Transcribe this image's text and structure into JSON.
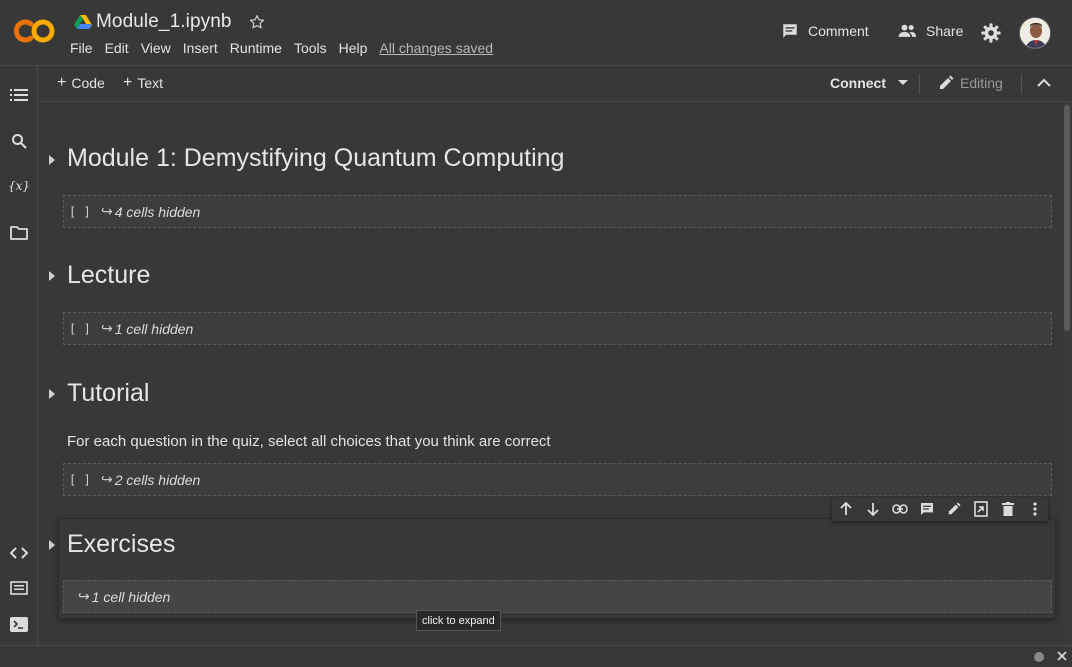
{
  "header": {
    "notebook_title": "Module_1.ipynb",
    "menu": [
      "File",
      "Edit",
      "View",
      "Insert",
      "Runtime",
      "Tools",
      "Help"
    ],
    "save_status": "All changes saved",
    "comment_label": "Comment",
    "share_label": "Share"
  },
  "toolbar": {
    "add_code_label": "Code",
    "add_text_label": "Text",
    "connect_label": "Connect",
    "editing_label": "Editing"
  },
  "rail": {
    "variables_label": "{x}"
  },
  "sections": [
    {
      "heading": "Module 1: Demystifying Quantum Computing",
      "hidden_label": "4 cells hidden"
    },
    {
      "heading": "Lecture",
      "hidden_label": "1 cell hidden"
    },
    {
      "heading": "Tutorial",
      "paragraph": "For each question in the quiz, select all choices that you think are correct",
      "hidden_label": "2 cells hidden"
    },
    {
      "heading": "Exercises",
      "hidden_label": "1 cell hidden"
    }
  ],
  "hidden_cell_prefix": "[ ]",
  "hidden_cell_arrow": "↪",
  "tooltip": "click to expand",
  "colors": {
    "background": "#383838",
    "logo_orange": "#f9ab00",
    "logo_orange_dark": "#e8710a"
  },
  "icons": [
    "colab-logo-icon",
    "drive-icon",
    "star-icon",
    "comment-icon",
    "share-icon",
    "gear-icon",
    "table-of-contents-icon",
    "search-icon",
    "folder-icon",
    "code-snippets-icon",
    "command-palette-icon",
    "terminal-icon",
    "pencil-icon",
    "chevron-up-icon",
    "arrow-up-icon",
    "arrow-down-icon",
    "link-icon",
    "comment-icon",
    "edit-icon",
    "mirror-cell-icon",
    "delete-icon",
    "more-vert-icon",
    "close-icon"
  ]
}
